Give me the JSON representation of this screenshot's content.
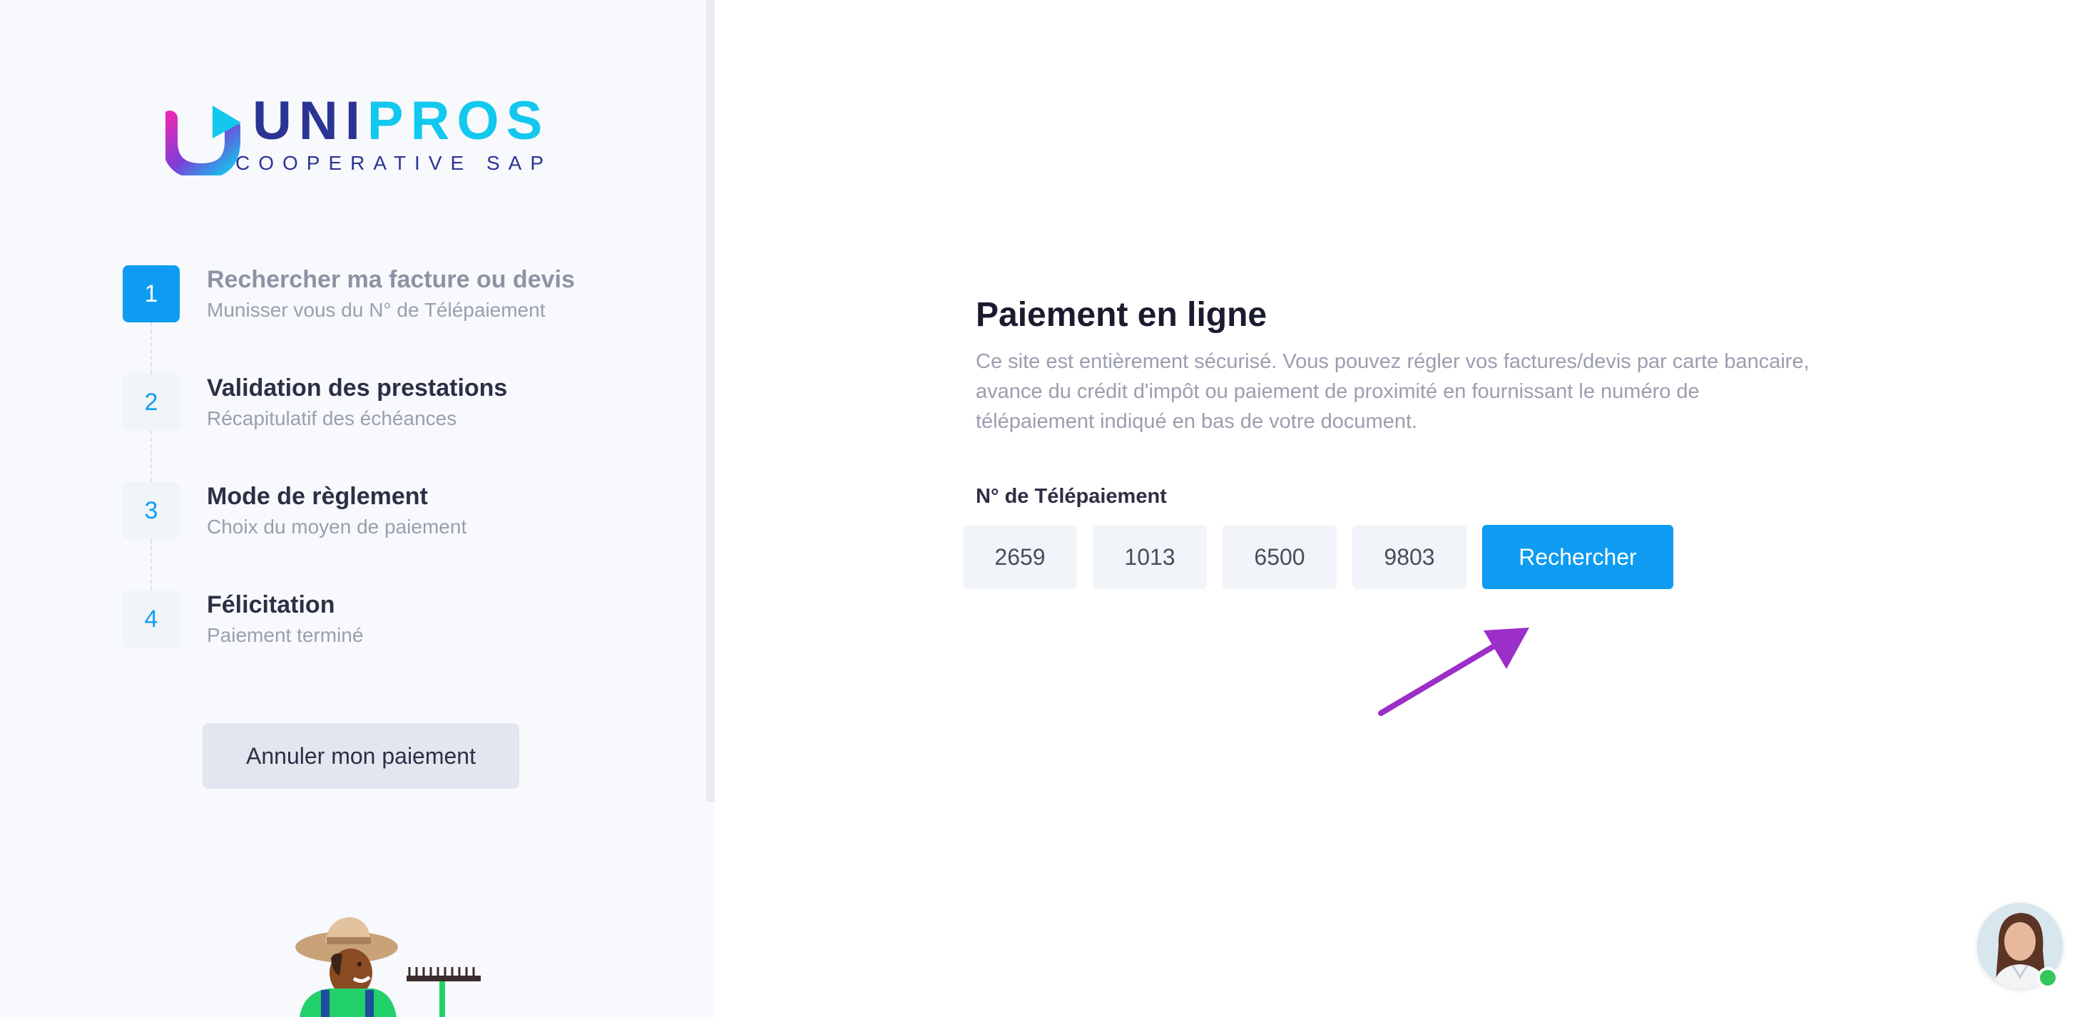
{
  "brand": {
    "name_part1": "UNI",
    "name_part2": "PROS",
    "tagline": "COOPERATIVE SAP",
    "colors": {
      "navy": "#2b3494",
      "cyan": "#13c8ee",
      "magenta": "#e32ab6"
    }
  },
  "steps": [
    {
      "number": "1",
      "title": "Rechercher ma facture ou devis",
      "subtitle": "Munisser vous du N° de Télépaiement",
      "active": true
    },
    {
      "number": "2",
      "title": "Validation des prestations",
      "subtitle": "Récapitulatif des échéances",
      "active": false
    },
    {
      "number": "3",
      "title": "Mode de règlement",
      "subtitle": "Choix du moyen de paiement",
      "active": false
    },
    {
      "number": "4",
      "title": "Félicitation",
      "subtitle": "Paiement terminé",
      "active": false
    }
  ],
  "cancel_label": "Annuler mon paiement",
  "main": {
    "title": "Paiement en ligne",
    "description": "Ce site est entièrement sécurisé. Vous pouvez régler vos factures/devis par carte bancaire, avance du crédit d'impôt ou paiement de proximité en fournissant le numéro de télépaiement indiqué en bas de votre document.",
    "field_label": "N° de Télépaiement",
    "code_parts": [
      "2659",
      "1013",
      "6500",
      "9803"
    ],
    "search_label": "Rechercher"
  },
  "icons": {
    "arrow": "annotation-arrow-icon",
    "chat": "chat-avatar",
    "gardener": "gardener-illustration"
  },
  "accent_color": "#0d9cf2",
  "arrow_color": "#9b2fc7"
}
